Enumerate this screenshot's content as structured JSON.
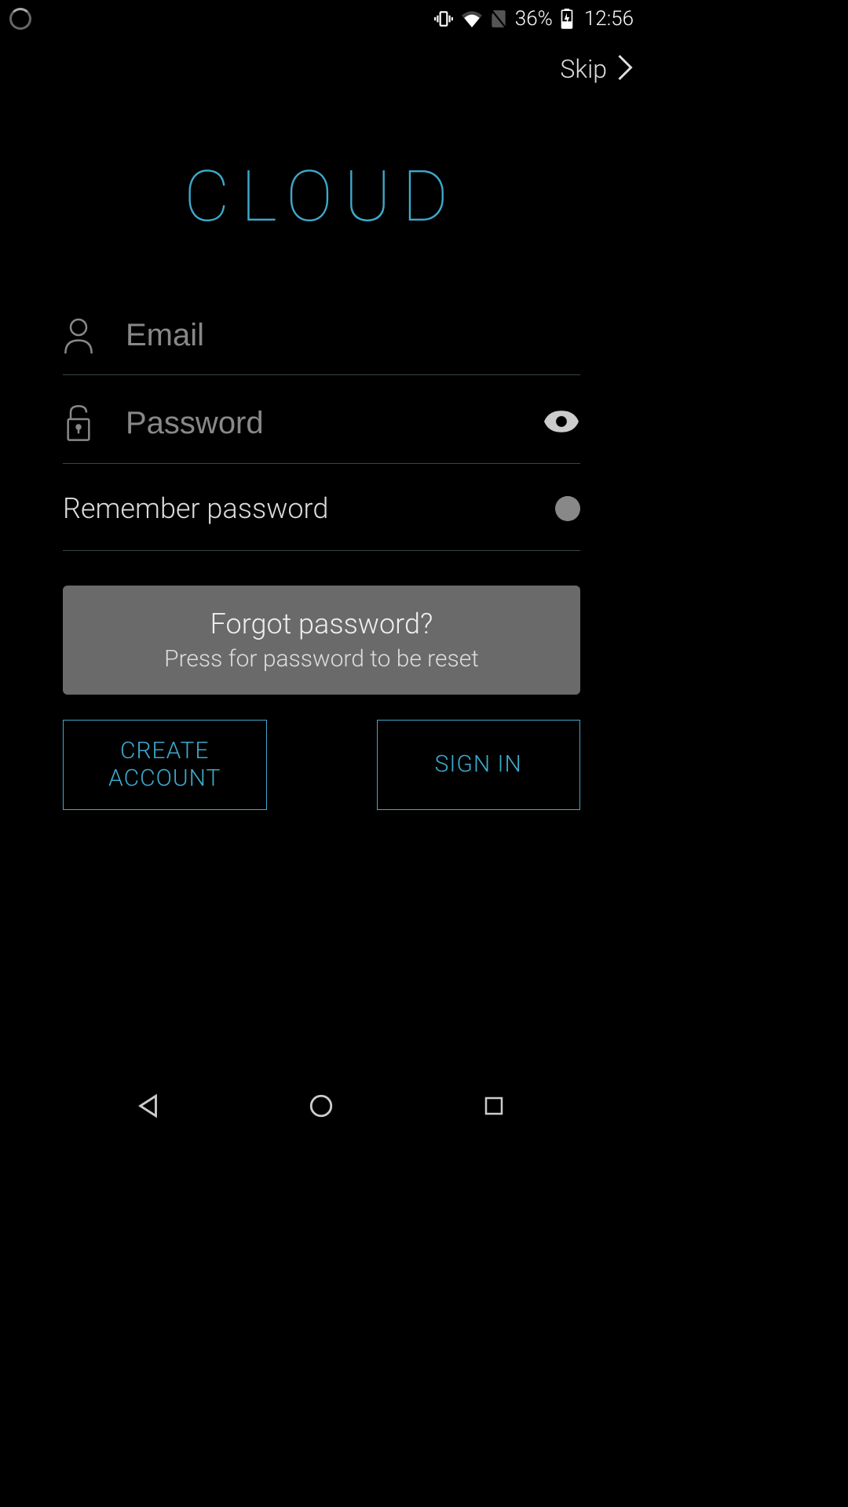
{
  "statusBar": {
    "batteryPercent": "36%",
    "time": "12:56"
  },
  "header": {
    "skipLabel": "Skip"
  },
  "title": "CLOUD",
  "form": {
    "emailPlaceholder": "Email",
    "emailValue": "",
    "passwordPlaceholder": "Password",
    "passwordValue": "",
    "rememberLabel": "Remember password",
    "rememberOn": false
  },
  "forgot": {
    "title": "Forgot password?",
    "subtitle": "Press for password to be reset"
  },
  "buttons": {
    "createAccount": "CREATE ACCOUNT",
    "signIn": "SIGN IN"
  },
  "colors": {
    "accent": "#3da9cc",
    "background": "#000000",
    "cardGray": "#6a6a6a"
  }
}
